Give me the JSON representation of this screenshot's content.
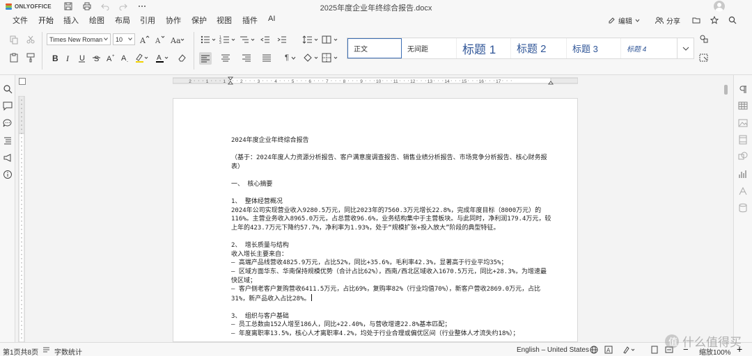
{
  "app": {
    "logo_text": "ONLYOFFICE",
    "doc_title": "2025年度企业年终综合报告.docx"
  },
  "menu": {
    "items": [
      "文件",
      "开始",
      "插入",
      "绘图",
      "布局",
      "引用",
      "协作",
      "保护",
      "视图",
      "插件",
      "AI"
    ],
    "active": "开始",
    "edit_label": "编辑",
    "share_label": "分享"
  },
  "toolbar": {
    "font_name": "Times New Roman",
    "font_size": "10",
    "styles": [
      "正文",
      "无间距",
      "标题 1",
      "标题 2",
      "标题 3",
      "标题 4"
    ],
    "bold": "B",
    "italic": "I",
    "underline": "U",
    "strike": "S",
    "superscript": "A",
    "subscript": "A",
    "paragraph_mark": "¶",
    "accent_color": "#446995",
    "highlight_color": "#f1d100",
    "font_color": "#000000"
  },
  "ruler": {
    "labels": [
      "2",
      "1",
      "1",
      "2",
      "3",
      "4",
      "5",
      "6",
      "7",
      "8",
      "9",
      "10",
      "11",
      "12",
      "13",
      "14",
      "15",
      "16",
      "17"
    ]
  },
  "document": {
    "title": "2024年度企业年终综合报告",
    "basis": "（基于：2024年度人力资源分析报告、客户满意度调查报告、销售业绩分析报告、市场竞争分析报告、核心财务报表）",
    "section1": "一、 核心摘要",
    "sub1_title": "1、 整体经营概况",
    "sub1_body": "2024年公司实现营业收入9280.5万元，同比2023年的7560.3万元增长22.8%，完成年度目标（8000万元）的116%。主营业务收入8965.0万元，占总营收96.6%，业务结构集中于主营板块。与此同时，净利润179.4万元，较上年的423.7万元下降约57.7%，净利率为1.93%，处于“规模扩张+投入放大”阶段的典型特征。",
    "sub2_title": "2、 增长质量与结构",
    "sub2_intro": "收入增长主要来自：",
    "sub2_item1": "– 高端产品线营收4825.9万元，占比52%，同比+35.6%，毛利率42.3%，显著高于行业平均35%；",
    "sub2_item2": "– 区域方面华东、华南保持规模优势（合计占比62%），西南/西北区域收入1670.5万元，同比+28.3%，为增速最快区域；",
    "sub2_item3": "– 客户侧老客户复购营收6411.5万元，占比69%，复购率82%（行业均值70%），新客户营收2869.0万元，占比31%，新产品收入占比28%。",
    "sub3_title": "3、 组织与客户基础",
    "sub3_item1": "– 员工总数由152人增至186人，同比+22.40%，与营收增速22.8%基本匹配；",
    "sub3_item2": "– 年度离职率13.5%，核心人才离职率4.2%，均处于行业合理或偏优区间（行业整体人才流失约18%）；"
  },
  "status": {
    "page_info": "第1页共8页",
    "word_count": "字数统计",
    "language": "English – United States",
    "zoom": "缩放100%",
    "watermark": "什么值得买"
  }
}
